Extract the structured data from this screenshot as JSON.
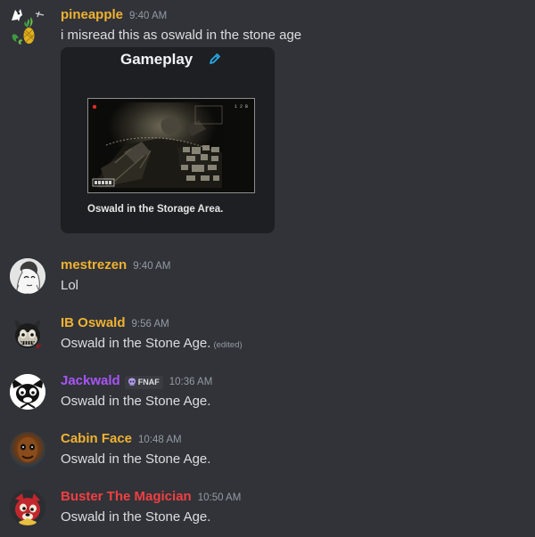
{
  "messages": [
    {
      "username": "pineapple",
      "username_color": "#f0b232",
      "time": "9:40 AM",
      "text": "i misread this as oswald in the stone age",
      "avatar_icon": "pineapple-icon",
      "embed": {
        "title": "Gameplay",
        "title_icon": "pencil-icon",
        "caption": "Oswald in the Storage Area."
      }
    },
    {
      "username": "mestrezen",
      "username_color": "#f0b232",
      "time": "9:40 AM",
      "text": "Lol",
      "avatar_icon": "sketch-character-icon"
    },
    {
      "username": "IB Oswald",
      "username_color": "#f0b232",
      "time": "9:56 AM",
      "text": "Oswald in the Stone Age.",
      "edited_label": "(edited)",
      "avatar_icon": "oswald-face-icon"
    },
    {
      "username": "Jackwald",
      "username_color": "#a855f7",
      "time": "10:36 AM",
      "text": "Oswald in the Stone Age.",
      "tag": {
        "label": "FNAF",
        "icon": "skull-icon"
      },
      "avatar_icon": "oswald-white-icon"
    },
    {
      "username": "Cabin Face",
      "username_color": "#f0b232",
      "time": "10:48 AM",
      "text": "Oswald in the Stone Age.",
      "avatar_icon": "cabin-face-icon"
    },
    {
      "username": "Buster The Magician",
      "username_color": "#f23f42",
      "time": "10:50 AM",
      "text": "Oswald in the Stone Age.",
      "avatar_icon": "buster-icon"
    }
  ]
}
